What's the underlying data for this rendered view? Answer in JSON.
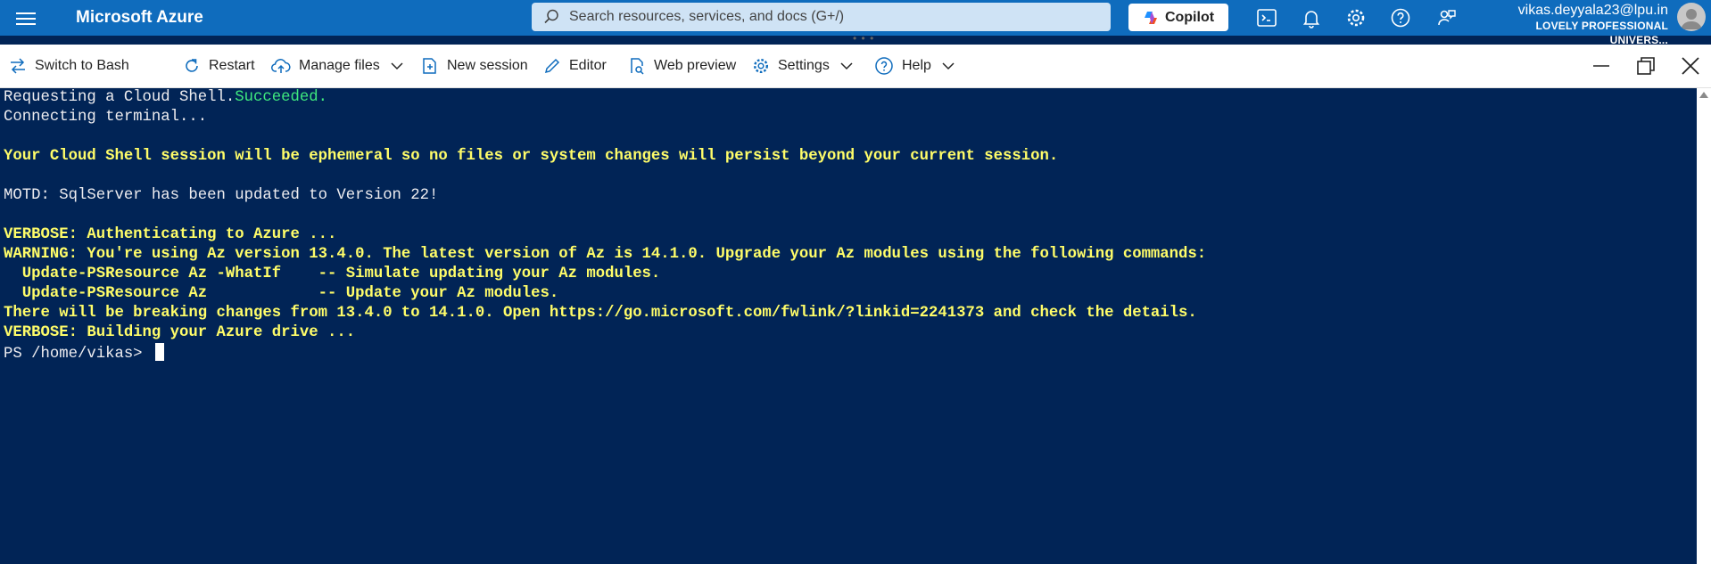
{
  "header": {
    "brand": "Microsoft Azure",
    "search_placeholder": "Search resources, services, and docs (G+/)",
    "copilot_label": "Copilot",
    "account_email": "vikas.deyyala23@lpu.in",
    "account_org": "LOVELY PROFESSIONAL UNIVERS..."
  },
  "toolbar": {
    "switch_label": "Switch to Bash",
    "restart_label": "Restart",
    "manage_files_label": "Manage files",
    "new_session_label": "New session",
    "editor_label": "Editor",
    "web_preview_label": "Web preview",
    "settings_label": "Settings",
    "help_label": "Help"
  },
  "terminal": {
    "lines": [
      {
        "text": "Requesting a Cloud Shell.",
        "suffix": "Succeeded.",
        "style": "w"
      },
      {
        "text": "Connecting terminal...",
        "style": "w"
      },
      {
        "text": "",
        "style": "w"
      },
      {
        "text": "Your Cloud Shell session will be ephemeral so no files or system changes will persist beyond your current session.",
        "style": "y"
      },
      {
        "text": "",
        "style": "w"
      },
      {
        "text": "MOTD: SqlServer has been updated to Version 22!",
        "style": "w"
      },
      {
        "text": "",
        "style": "w"
      },
      {
        "text": "VERBOSE: Authenticating to Azure ...",
        "style": "y"
      },
      {
        "text": "WARNING: You're using Az version 13.4.0. The latest version of Az is 14.1.0. Upgrade your Az modules using the following commands:",
        "style": "y"
      },
      {
        "text": "  Update-PSResource Az -WhatIf    -- Simulate updating your Az modules.",
        "style": "y"
      },
      {
        "text": "  Update-PSResource Az            -- Update your Az modules.",
        "style": "y"
      },
      {
        "text": "There will be breaking changes from 13.4.0 to 14.1.0. Open https://go.microsoft.com/fwlink/?linkid=2241373 and check the details.",
        "style": "y"
      },
      {
        "text": "VERBOSE: Building your Azure drive ...",
        "style": "y"
      }
    ],
    "prompt": "PS /home/vikas> "
  },
  "colors": {
    "azure_blue": "#0f6cbd",
    "terminal_bg": "#012456",
    "terminal_yellow": "#fffd69",
    "terminal_green": "#3fe97e"
  }
}
